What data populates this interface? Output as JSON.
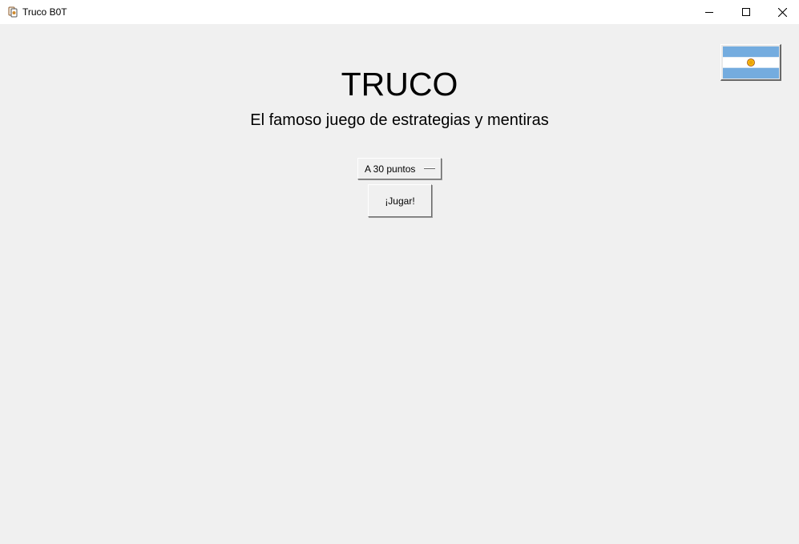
{
  "window": {
    "title": "Truco B0T",
    "controls": {
      "minimize_icon": "minimize-icon",
      "maximize_icon": "maximize-icon",
      "close_icon": "close-icon"
    }
  },
  "header": {
    "title": "TRUCO",
    "subtitle": "El famoso juego de estrategias y mentiras"
  },
  "language": {
    "icon": "argentina-flag-icon",
    "colors": {
      "celeste": "#74acdf",
      "white": "#ffffff",
      "sun": "#f6b40e"
    }
  },
  "game": {
    "points_selected": "A 30 puntos",
    "play_label": "¡Jugar!"
  },
  "colors": {
    "background": "#f0f0f0",
    "titlebar": "#ffffff",
    "text": "#000000"
  }
}
